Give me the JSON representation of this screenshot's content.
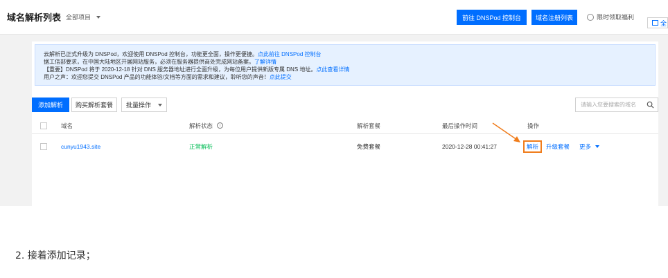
{
  "header": {
    "title": "域名解析列表",
    "project_select": "全部项目",
    "dnspod_button": "前往 DNSPod 控制台",
    "register_button": "域名注册列表",
    "promo_text": "限时领取福利",
    "side_button": "全"
  },
  "notice": {
    "line1_text": "云解析已正式升级为 DNSPod，欢迎使用 DNSPod 控制台，功能更全面，操作更便捷。",
    "line1_link": "点此前往 DNSPod 控制台",
    "line2_text": "据工信部要求，在中国大陆地区开展网站服务，必须在服务器提供商处完成网站备案。",
    "line2_link": "了解详情",
    "line3_text": "【重要】DNSPod 将于 2020-12-18 针对 DNS 服务器地址进行全面升级，为每位用户提供新版专属 DNS 地址。",
    "line3_link": "点此查看详情",
    "line4_text": "用户之声：欢迎您提交 DNSPod 产品的功能体验/文档等方面的需求和建议，聆听您的声音！",
    "line4_link": "点此提交"
  },
  "toolbar": {
    "add_button": "添加解析",
    "buy_button": "购买解析套餐",
    "batch_button": "批量操作",
    "search_placeholder": "请输入您要搜索的域名"
  },
  "table": {
    "columns": [
      "域名",
      "解析状态",
      "解析套餐",
      "最后操作时间",
      "操作"
    ],
    "rows": [
      {
        "domain": "cunyu1943.site",
        "status": "正常解析",
        "package": "免费套餐",
        "last_time": "2020-12-28 00:41:27",
        "op_resolve": "解析",
        "op_upgrade": "升级套餐",
        "op_more": "更多"
      }
    ]
  },
  "caption": "2. 接着添加记录；",
  "colors": {
    "accent": "#006eff",
    "status_ok": "#0abf5b",
    "highlight": "#f07c1b"
  }
}
